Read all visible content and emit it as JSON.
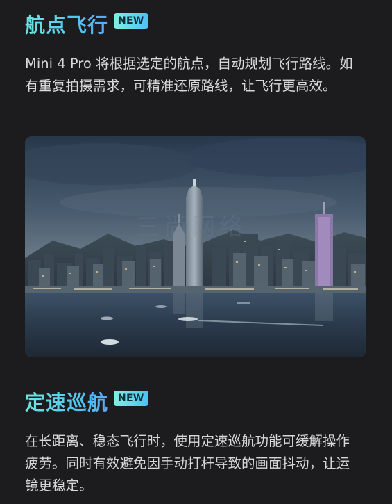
{
  "waypoint": {
    "title": "航点飞行",
    "badge": "NEW",
    "description": "Mini 4 Pro 将根据选定的航点，自动规划飞行路线。如有重复拍摄需求，可精准还原路线，让飞行更高效。"
  },
  "cruise": {
    "title": "定速巡航",
    "badge": "NEW",
    "description": "在长距离、稳态飞行时，使用定速巡航功能可缓解操作疲劳。同时有效避免因手动打杆导致的画面抖动，让运镜更稳定。"
  },
  "photo": {
    "subject": "harbor-city-skyline",
    "watermark": "三尚网络"
  },
  "colors": {
    "background": "#1c1c1e",
    "title_gradient_start": "#6fe3df",
    "title_gradient_end": "#5aa8f7",
    "body_text": "#d8d8d8"
  }
}
